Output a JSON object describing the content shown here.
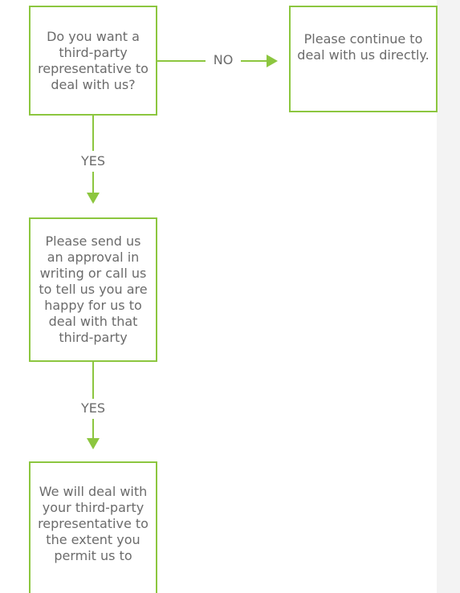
{
  "boxes": {
    "question": "Do you want a third-party representative to deal with us?",
    "direct": "Please continue to deal with us directly.",
    "approval": "Please send us an approval in writing or call us to tell us you are happy for us to deal with that third-party",
    "result": "We will deal with your third-party representative to the extent you permit us to"
  },
  "edges": {
    "no_label": "NO",
    "yes_label_1": "YES",
    "yes_label_2": "YES"
  },
  "colors": {
    "accent": "#8cc63f",
    "text": "#6b6b6b"
  }
}
